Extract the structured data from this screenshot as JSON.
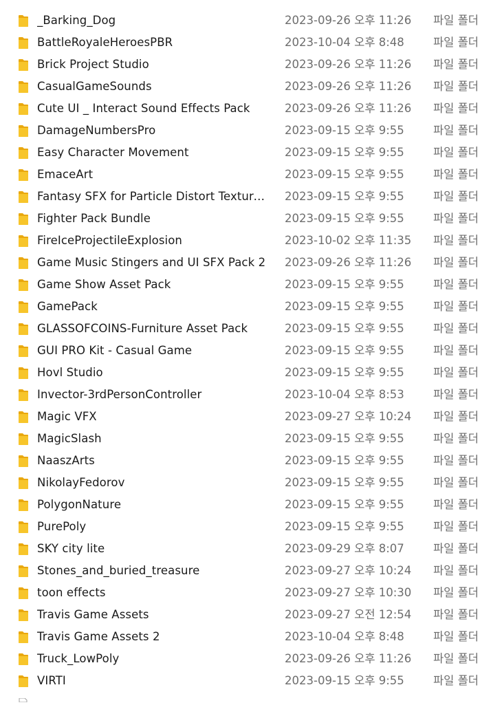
{
  "files": [
    {
      "name": "_Barking_Dog",
      "modified": "2023-09-26 오후 11:26",
      "type": "파일 폴더"
    },
    {
      "name": "BattleRoyaleHeroesPBR",
      "modified": "2023-10-04 오후 8:48",
      "type": "파일 폴더"
    },
    {
      "name": "Brick Project Studio",
      "modified": "2023-09-26 오후 11:26",
      "type": "파일 폴더"
    },
    {
      "name": "CasualGameSounds",
      "modified": "2023-09-26 오후 11:26",
      "type": "파일 폴더"
    },
    {
      "name": "Cute UI _ Interact Sound Effects Pack",
      "modified": "2023-09-26 오후 11:26",
      "type": "파일 폴더"
    },
    {
      "name": "DamageNumbersPro",
      "modified": "2023-09-15 오후 9:55",
      "type": "파일 폴더"
    },
    {
      "name": "Easy Character Movement",
      "modified": "2023-09-15 오후 9:55",
      "type": "파일 폴더"
    },
    {
      "name": "EmaceArt",
      "modified": "2023-09-15 오후 9:55",
      "type": "파일 폴더"
    },
    {
      "name": "Fantasy SFX for Particle Distort Texture ...",
      "modified": "2023-09-15 오후 9:55",
      "type": "파일 폴더"
    },
    {
      "name": "Fighter Pack Bundle",
      "modified": "2023-09-15 오후 9:55",
      "type": "파일 폴더"
    },
    {
      "name": "FireIceProjectileExplosion",
      "modified": "2023-10-02 오후 11:35",
      "type": "파일 폴더"
    },
    {
      "name": "Game Music Stingers and UI SFX Pack 2",
      "modified": "2023-09-26 오후 11:26",
      "type": "파일 폴더"
    },
    {
      "name": "Game Show Asset Pack",
      "modified": "2023-09-15 오후 9:55",
      "type": "파일 폴더"
    },
    {
      "name": "GamePack",
      "modified": "2023-09-15 오후 9:55",
      "type": "파일 폴더"
    },
    {
      "name": "GLASSOFCOINS-Furniture Asset Pack",
      "modified": "2023-09-15 오후 9:55",
      "type": "파일 폴더"
    },
    {
      "name": "GUI PRO Kit - Casual Game",
      "modified": "2023-09-15 오후 9:55",
      "type": "파일 폴더"
    },
    {
      "name": "Hovl Studio",
      "modified": "2023-09-15 오후 9:55",
      "type": "파일 폴더"
    },
    {
      "name": "Invector-3rdPersonController",
      "modified": "2023-10-04 오후 8:53",
      "type": "파일 폴더"
    },
    {
      "name": "Magic VFX",
      "modified": "2023-09-27 오후 10:24",
      "type": "파일 폴더"
    },
    {
      "name": "MagicSlash",
      "modified": "2023-09-15 오후 9:55",
      "type": "파일 폴더"
    },
    {
      "name": "NaaszArts",
      "modified": "2023-09-15 오후 9:55",
      "type": "파일 폴더"
    },
    {
      "name": "NikolayFedorov",
      "modified": "2023-09-15 오후 9:55",
      "type": "파일 폴더"
    },
    {
      "name": "PolygonNature",
      "modified": "2023-09-15 오후 9:55",
      "type": "파일 폴더"
    },
    {
      "name": "PurePoly",
      "modified": "2023-09-15 오후 9:55",
      "type": "파일 폴더"
    },
    {
      "name": "SKY city lite",
      "modified": "2023-09-29 오후 8:07",
      "type": "파일 폴더"
    },
    {
      "name": "Stones_and_buried_treasure",
      "modified": "2023-09-27 오후 10:24",
      "type": "파일 폴더"
    },
    {
      "name": "toon effects",
      "modified": "2023-09-27 오후 10:30",
      "type": "파일 폴더"
    },
    {
      "name": "Travis Game Assets",
      "modified": "2023-09-27 오전 12:54",
      "type": "파일 폴더"
    },
    {
      "name": "Travis Game Assets 2",
      "modified": "2023-10-04 오후 8:48",
      "type": "파일 폴더"
    },
    {
      "name": "Truck_LowPoly",
      "modified": "2023-09-26 오후 11:26",
      "type": "파일 폴더"
    },
    {
      "name": "VIRTI",
      "modified": "2023-09-15 오후 9:55",
      "type": "파일 폴더"
    }
  ],
  "icons": {
    "folder": "folder-icon",
    "partial_file": "file-icon"
  },
  "colors": {
    "folder_body": "#f7c52b",
    "folder_back": "#e9a80f",
    "name_text": "#1a1a1a",
    "meta_text": "#6d6d6d",
    "background": "#ffffff"
  }
}
